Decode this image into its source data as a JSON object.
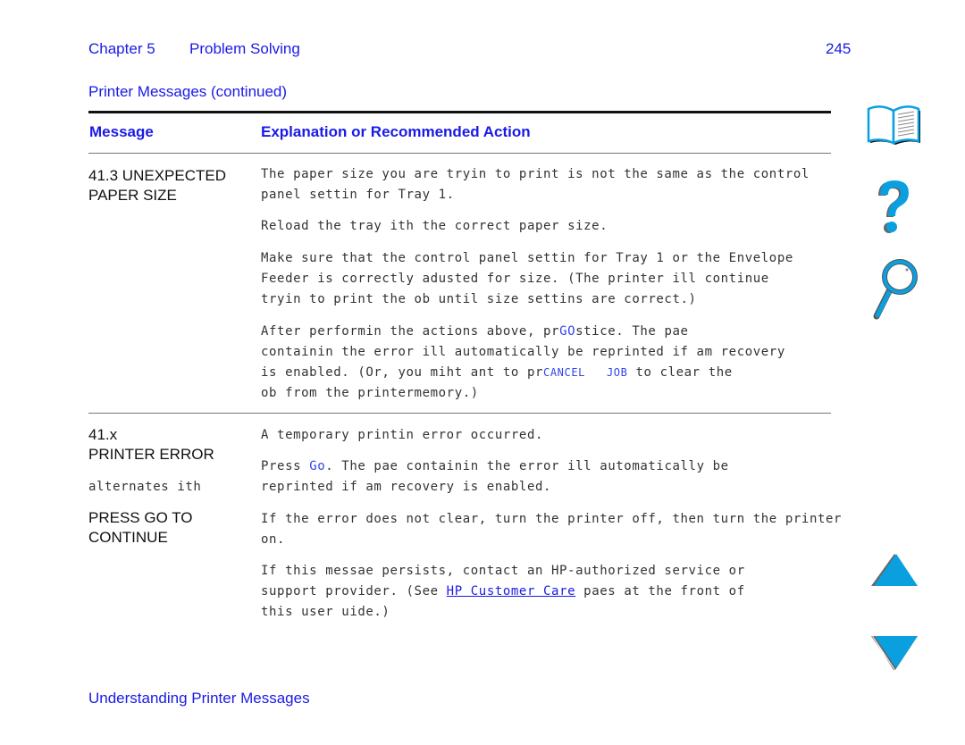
{
  "header": {
    "chapter": "Chapter 5",
    "section": "Problem Solving",
    "page_number": "245",
    "subtitle": "Printer Messages (continued)"
  },
  "table": {
    "columns": [
      "Message",
      "Explanation or Recommended Action"
    ],
    "rows": [
      {
        "message_lines": [
          "41.3 UNEXPECTED",
          "PAPER SIZE"
        ],
        "paragraphs": [
          [
            "The paper size you are tryin to print is not the same as the control",
            "panel settin for Tray 1."
          ],
          [
            "Reload the tray ith the correct paper size."
          ],
          [
            "Make sure that the control panel settin for Tray 1 or the Envelope",
            "Feeder is correctly adusted for size. (The printer ill continue",
            "tryin to print the ob until size settins are correct.)"
          ],
          {
            "line1_pre": "After performin the actions above, pr",
            "line1_key": "GO",
            "line1_post": "stice. The pae",
            "line2": "containin the error ill automatically be reprinted if am recovery",
            "line3_pre": "is enabled. (Or, you miht ant to pr",
            "line3_key1": "CANCEL",
            "line3_key2": "JOB",
            "line3_post": " to clear the",
            "line4": "ob from the printermemory.)"
          }
        ]
      },
      {
        "message_lines": [
          "41.x",
          "PRINTER ERROR"
        ],
        "alternates": "alternates ith",
        "message_lines_2": [
          "PRESS GO TO",
          "CONTINUE"
        ],
        "paragraphs": [
          [
            "A temporary printin error occurred."
          ],
          {
            "line1_pre": "Press ",
            "line1_key": "Go",
            "line1_post": ". The pae containin the error ill automatically be",
            "line2": "reprinted if am recovery is enabled."
          },
          [
            "If the error does not clear, turn the printer off, then turn the printer",
            "on."
          ],
          {
            "line1": "If this messae persists, contact an HP-authorized service or",
            "line2_pre": "support provider. (See ",
            "line2_link": "HP Customer Care",
            "line2_post": " paes at the front of",
            "line3": "this user uide.)"
          }
        ]
      }
    ]
  },
  "footer": {
    "link": "Understanding Printer Messages"
  },
  "icons": {
    "contents": "book-icon",
    "help": "question-mark-icon",
    "index": "magnifier-icon",
    "prev": "up-arrow-icon",
    "next": "down-arrow-icon",
    "accent": "#0aa0e0"
  }
}
